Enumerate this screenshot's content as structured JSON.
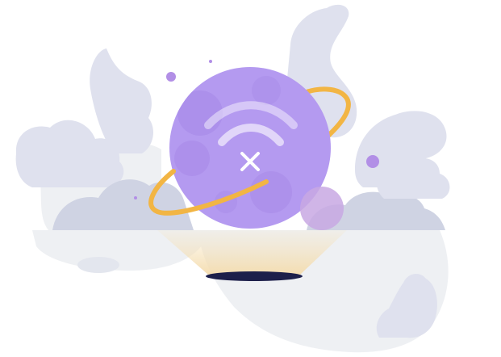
{
  "illustration": {
    "icon": "wifi-off-icon",
    "colors": {
      "planet": "#b49af0",
      "planet_crater": "#a88be8",
      "ring": "#f2b544",
      "wifi": "#ffffff",
      "smoke": "#dfe1ee",
      "smoke_dark": "#cfd3e3",
      "ground": "#eef0f3",
      "beam": "#f6e2b8",
      "hole": "#1d1f4a",
      "moon": "#c8a8e3",
      "dot": "#b28fe6"
    }
  }
}
